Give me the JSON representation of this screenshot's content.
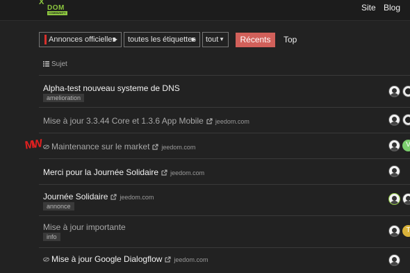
{
  "header": {
    "logo": {
      "x": "X",
      "text": "DOM",
      "sub": "COMMUNITY"
    },
    "nav": {
      "site": "Site",
      "blog": "Blog"
    }
  },
  "filters": {
    "category": "Annonces officielles",
    "tags": "toutes les étiquettes",
    "period": "tout",
    "recent_label": "Récents",
    "top_label": "Top",
    "accent_color": "#d1605a"
  },
  "list_header": {
    "subject": "Sujet"
  },
  "annotation_mark": "MW",
  "topics": [
    {
      "title": "Alpha-test nouveau systeme de DNS",
      "tag": "amelioration",
      "domain": "",
      "read": false
    },
    {
      "title": "Mise à jour 3.3.44 Core et 1.3.6 App Mobile",
      "tag": "",
      "domain": "jeedom.com",
      "read": true
    },
    {
      "title": "Maintenance sur le market",
      "tag": "",
      "domain": "jeedom.com",
      "read": true,
      "unlisted": true
    },
    {
      "title": "Merci pour la Journée Solidaire",
      "tag": "",
      "domain": "jeedom.com",
      "read": false
    },
    {
      "title": "Journée Solidaire",
      "tag": "annonce",
      "domain": "jeedom.com",
      "read": false
    },
    {
      "title": "Mise à jour importante",
      "tag": "info",
      "domain": "",
      "read": true
    },
    {
      "title": "Mise à jour Google Dialogflow",
      "tag": "",
      "domain": "jeedom.com",
      "read": false,
      "unlisted": true
    }
  ],
  "avatar_letters": {
    "green": "V",
    "yellow": "T"
  }
}
